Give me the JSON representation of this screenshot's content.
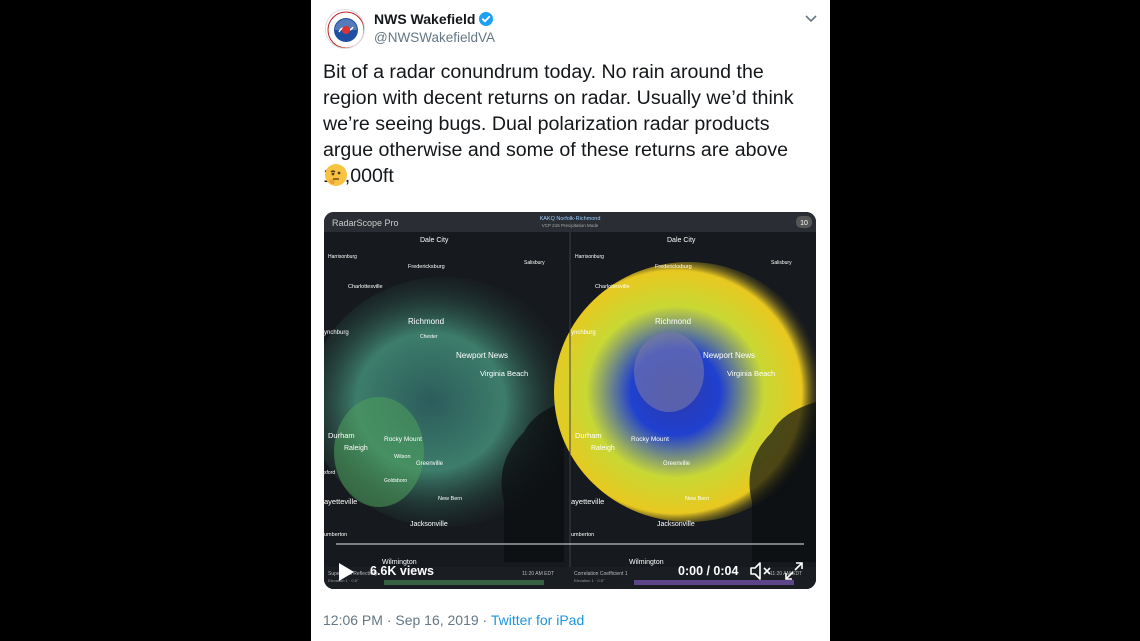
{
  "tweet": {
    "display_name": "NWS Wakefield",
    "handle": "@NWSWakefieldVA",
    "text": "Bit of a radar conundrum today. No rain around the region with decent returns on radar. Usually we’d think we’re seeing bugs. Dual polarization radar products argue otherwise and some of these returns are above 10,000ft",
    "emoji": "thinking-face",
    "timestamp": "12:06 PM · Sep 16, 2019",
    "separator": " · ",
    "source": "Twitter for iPad"
  },
  "video": {
    "views": "6.6K views",
    "time": "0:00 / 0:04",
    "app_name": "RadarScope Pro",
    "station": "KAKQ Norfolk-Richmond",
    "mode": "VCP 215 Precipitation Mode",
    "badge": "10",
    "left_product": "Super-Res Reflectivity",
    "right_product": "Correlation Coefficient 1",
    "left_elev": "Elevation 1 · 0.5°",
    "right_elev": "Elevation 1 · 0.5°",
    "left_time": "11:20 AM EDT",
    "right_time": "11:20 AM EDT",
    "cities": {
      "dale_city": "Dale City",
      "harrisonburg": "Harrisonburg",
      "fredericksburg": "Fredericksburg",
      "salisbury": "Salisbury",
      "charlottesville": "Charlottesville",
      "richmond": "Richmond",
      "lynchburg": "ynchburg",
      "chester": "Chester",
      "newport_news": "Newport News",
      "virginia_beach": "Virginia Beach",
      "durham": "Durham",
      "raleigh": "Raleigh",
      "rocky_mount": "Rocky Mount",
      "greenville": "Greenville",
      "wilson": "Wilson",
      "oxford": "xford",
      "goldsboro": "Goldsboro",
      "fayetteville": "ayetteville",
      "new_bern": "New Bern",
      "jacksonville": "Jacksonville",
      "lumberton": "umberton",
      "wilmington": "Wilmington"
    }
  },
  "colors": {
    "link": "#1b95e0",
    "verified": "#1da1f2",
    "text": "#14171a",
    "muted": "#657786"
  }
}
